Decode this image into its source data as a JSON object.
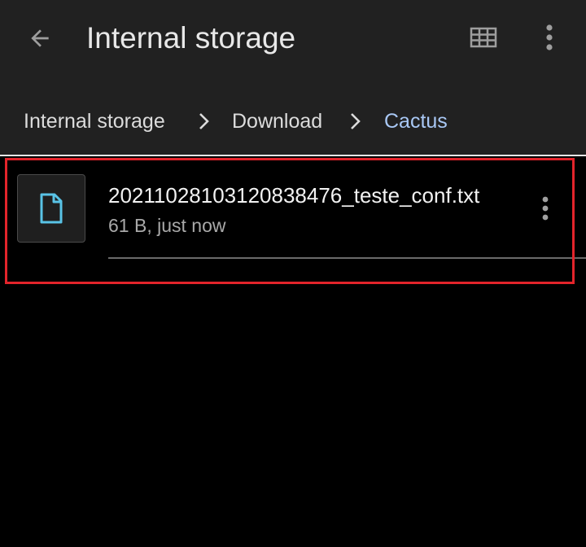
{
  "header": {
    "title": "Internal storage",
    "back_icon": "arrow-left-icon",
    "grid_icon": "grid-view-icon",
    "more_icon": "more-vertical-icon"
  },
  "breadcrumb": {
    "items": [
      {
        "label": "Internal storage",
        "active": false
      },
      {
        "label": "Download",
        "active": false
      },
      {
        "label": "Cactus",
        "active": true
      }
    ],
    "separator_icon": "chevron-right-icon"
  },
  "files": [
    {
      "name": "20211028103120838476_teste_conf.txt",
      "meta": "61 B, just now",
      "icon": "file-icon",
      "more_icon": "more-vertical-icon",
      "highlighted": true
    }
  ],
  "colors": {
    "topbar_bg": "#212121",
    "page_bg": "#000000",
    "accent": "#a9c8f5",
    "file_icon": "#59c3e6",
    "highlight": "#e3242b"
  }
}
